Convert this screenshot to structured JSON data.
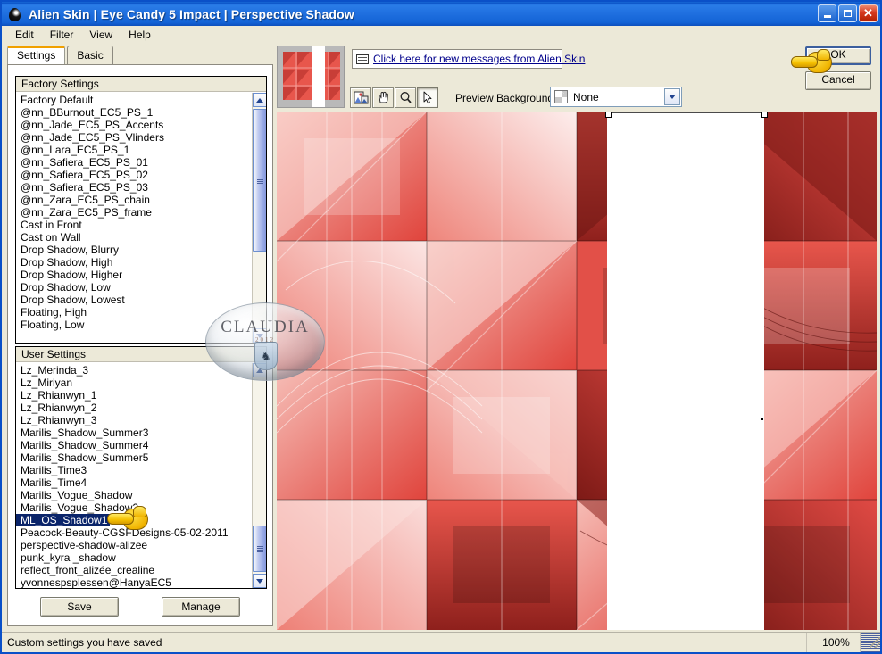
{
  "window": {
    "title": "Alien Skin | Eye Candy 5 Impact | Perspective Shadow",
    "icon": "alien-head-icon",
    "minimize_label": "–",
    "maximize_label": "□",
    "close_label": "✕"
  },
  "menu": {
    "items": [
      "Edit",
      "Filter",
      "View",
      "Help"
    ]
  },
  "tabs": [
    {
      "label": "Settings",
      "active": true
    },
    {
      "label": "Basic",
      "active": false
    }
  ],
  "factory_settings": {
    "header": "Factory Settings",
    "items": [
      "Factory Default",
      "@nn_BBurnout_EC5_PS_1",
      "@nn_Jade_EC5_PS_Accents",
      "@nn_Jade_EC5_PS_Vlinders",
      "@nn_Lara_EC5_PS_1",
      "@nn_Safiera_EC5_PS_01",
      "@nn_Safiera_EC5_PS_02",
      "@nn_Safiera_EC5_PS_03",
      "@nn_Zara_EC5_PS_chain",
      "@nn_Zara_EC5_PS_frame",
      "Cast in Front",
      "Cast on Wall",
      "Drop Shadow, Blurry",
      "Drop Shadow, High",
      "Drop Shadow, Higher",
      "Drop Shadow, Low",
      "Drop Shadow, Lowest",
      "Floating, High",
      "Floating, Low"
    ]
  },
  "user_settings": {
    "header": "User Settings",
    "selected": "ML_OS_Shadow1",
    "items": [
      "Lz_Merinda_3",
      "Lz_Miriyan",
      "Lz_Rhianwyn_1",
      "Lz_Rhianwyn_2",
      "Lz_Rhianwyn_3",
      "Marilis_Shadow_Summer3",
      "Marilis_Shadow_Summer4",
      "Marilis_Shadow_Summer5",
      "Marilis_Time3",
      "Marilis_Time4",
      "Marilis_Vogue_Shadow",
      "Marilis_Vogue_Shadow2",
      "ML_OS_Shadow1",
      "Peacock-Beauty-CGSFDesigns-05-02-2011",
      "perspective-shadow-alizee",
      "punk_kyra _shadow",
      "reflect_front_alizée_crealine",
      "yvonnespsplessen@HanyaEC5"
    ]
  },
  "left_buttons": {
    "save": "Save",
    "manage": "Manage"
  },
  "message_bar": {
    "icon": "envelope-icon",
    "link_text": "Click here for new messages from Alien Skin"
  },
  "toolbar": {
    "tools": [
      {
        "name": "preview-compare-icon",
        "active": false
      },
      {
        "name": "hand-pan-icon",
        "active": false
      },
      {
        "name": "magnifier-zoom-icon",
        "active": false
      },
      {
        "name": "arrow-select-icon",
        "active": true
      }
    ],
    "preview_background_label": "Preview Background:",
    "preview_background_value": "None"
  },
  "action_buttons": {
    "ok": "OK",
    "cancel": "Cancel"
  },
  "status_bar": {
    "message": "Custom settings you have saved",
    "zoom": "100%"
  },
  "watermark": {
    "text": "CLAUDIA",
    "subtext": "2012"
  },
  "colors": {
    "title_blue": "#1f6fdf",
    "selection_blue": "#0a246a",
    "tab_accent_orange": "#f0a000",
    "panel_bg": "#ece9d8",
    "link_blue": "#00008b",
    "art_red": "#e04a44"
  }
}
